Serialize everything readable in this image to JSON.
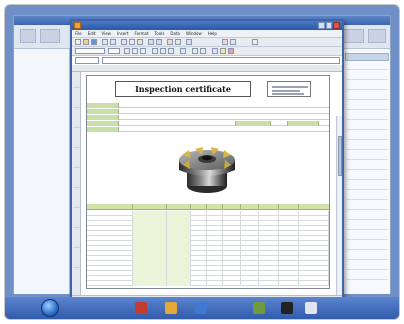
{
  "window": {
    "title": "",
    "menu": [
      "File",
      "Edit",
      "View",
      "Insert",
      "Format",
      "Tools",
      "Data",
      "Window",
      "Help"
    ]
  },
  "certificate": {
    "title": "Inspection certificate",
    "info_labels": [
      "",
      "",
      "",
      "",
      ""
    ],
    "info_values": [
      "",
      "",
      "",
      "",
      ""
    ]
  },
  "sheet_tabs": [
    "",
    "",
    ""
  ],
  "colors": {
    "titlebar": "#2a58a6",
    "desktop": "#6f8fc7",
    "label_green": "#c8e0a8",
    "header_green": "#cfe3a6"
  },
  "icons": {
    "start": "start-orb-icon",
    "app": "spreadsheet-app-icon",
    "tool": "milling-cutter-image"
  }
}
